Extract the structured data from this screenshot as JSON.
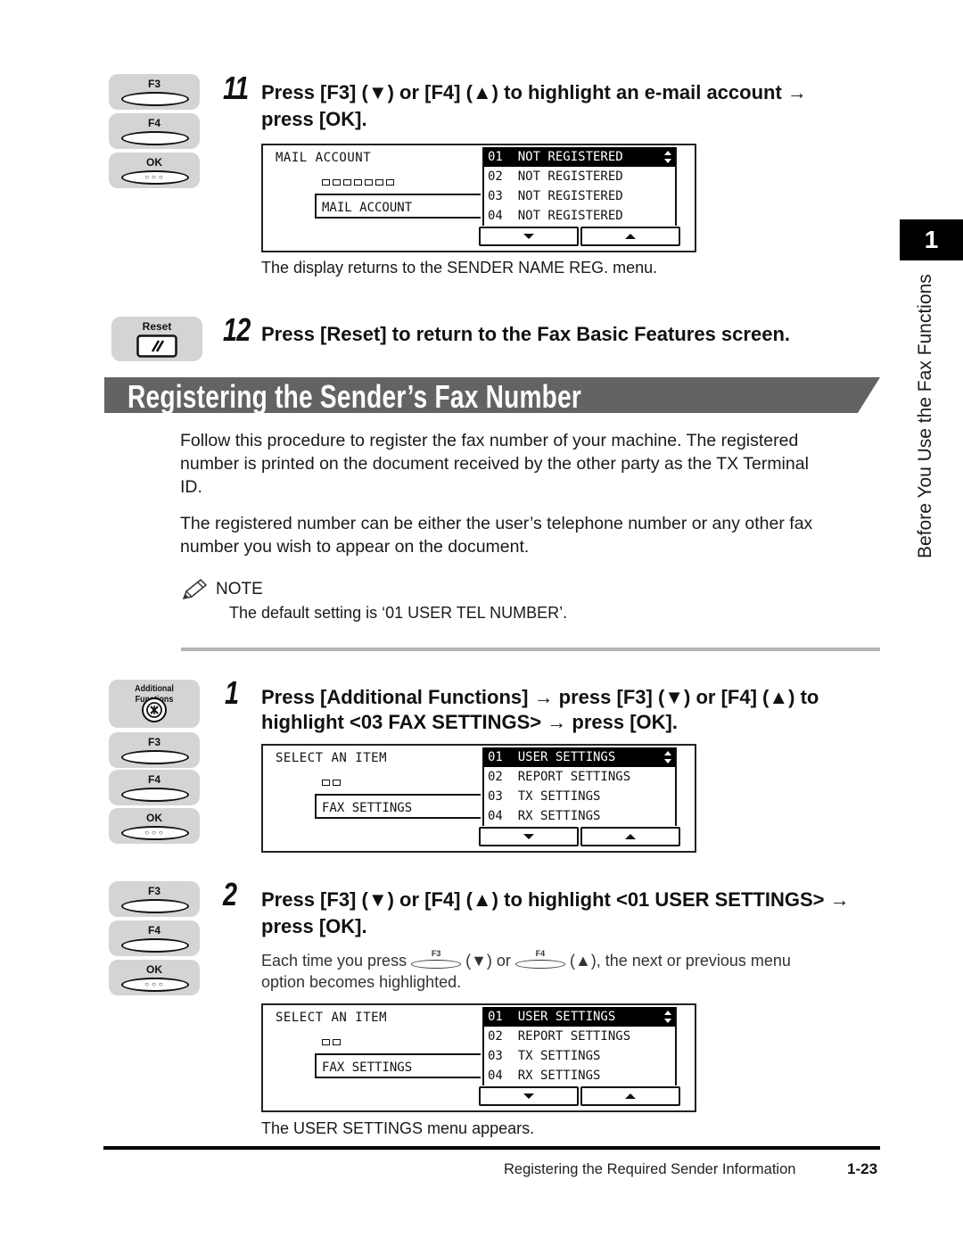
{
  "step11": {
    "number": "11",
    "line1": "Press [F3] (▼) or [F4] (▲) to highlight an e-mail account →",
    "line2": "press [OK].",
    "keys": {
      "f3": "F3",
      "f4": "F4",
      "ok": "OK",
      "ok_dots": "○○○"
    },
    "screen": {
      "title": "MAIL ACCOUNT",
      "field": "MAIL ACCOUNT",
      "square_count": 7,
      "items": [
        "01  NOT REGISTERED",
        "02  NOT REGISTERED",
        "03  NOT REGISTERED",
        "04  NOT REGISTERED"
      ],
      "selected_index": 0
    },
    "caption": "The display returns to the SENDER NAME REG. menu."
  },
  "step12": {
    "number": "12",
    "text": "Press [Reset] to return to the Fax Basic Features screen.",
    "key_label": "Reset"
  },
  "section": {
    "title": "Registering the Sender’s Fax Number",
    "para1_l1": "Follow this procedure to register the fax number of your machine. The registered",
    "para1_l2": "number is printed on the document received by the other party as the TX Terminal",
    "para1_l3": "ID.",
    "para2_l1": "The registered number can be either the user’s telephone number or any other fax",
    "para2_l2": "number you wish to appear on the document.",
    "note_label": "NOTE",
    "note_text": "The default setting is ‘01 USER TEL NUMBER’."
  },
  "step1": {
    "number": "1",
    "line1": "Press [Additional Functions] → press [F3] (▼) or [F4] (▲) to",
    "line2": "highlight <03 FAX SETTINGS> → press [OK].",
    "keys": {
      "additional": "Additional Functions",
      "f3": "F3",
      "f4": "F4",
      "ok": "OK",
      "ok_dots": "○○○"
    },
    "screen": {
      "title": "SELECT AN ITEM",
      "field": "FAX SETTINGS",
      "square_count": 2,
      "items": [
        "01  USER SETTINGS",
        "02  REPORT SETTINGS",
        "03  TX SETTINGS",
        "04  RX SETTINGS"
      ],
      "selected_index": 0
    }
  },
  "step2": {
    "number": "2",
    "line1": "Press [F3] (▼) or [F4] (▲) to highlight <01 USER SETTINGS> →",
    "line2": "press [OK].",
    "keys": {
      "f3": "F3",
      "f4": "F4",
      "ok": "OK",
      "ok_dots": "○○○"
    },
    "desc_part1": "Each time you press",
    "desc_key1": "F3",
    "desc_part2": "(▼) or",
    "desc_key2": "F4",
    "desc_part3": "(▲), the next or previous menu",
    "desc_line2": "option becomes highlighted.",
    "screen": {
      "title": "SELECT AN ITEM",
      "field": "FAX SETTINGS",
      "square_count": 2,
      "items": [
        "01  USER SETTINGS",
        "02  REPORT SETTINGS",
        "03  TX SETTINGS",
        "04  RX SETTINGS"
      ],
      "selected_index": 0
    },
    "caption": "The USER SETTINGS menu appears."
  },
  "sidebar": {
    "chapter_number": "1",
    "chapter_title": "Before You Use the Fax Functions"
  },
  "footer": {
    "section_title": "Registering the Required Sender Information",
    "page_number": "1-23"
  },
  "colors": {
    "banner": "#636363",
    "key_bg": "#d4d4d4",
    "divider": "#b3b3b3",
    "tab": "#000000"
  }
}
